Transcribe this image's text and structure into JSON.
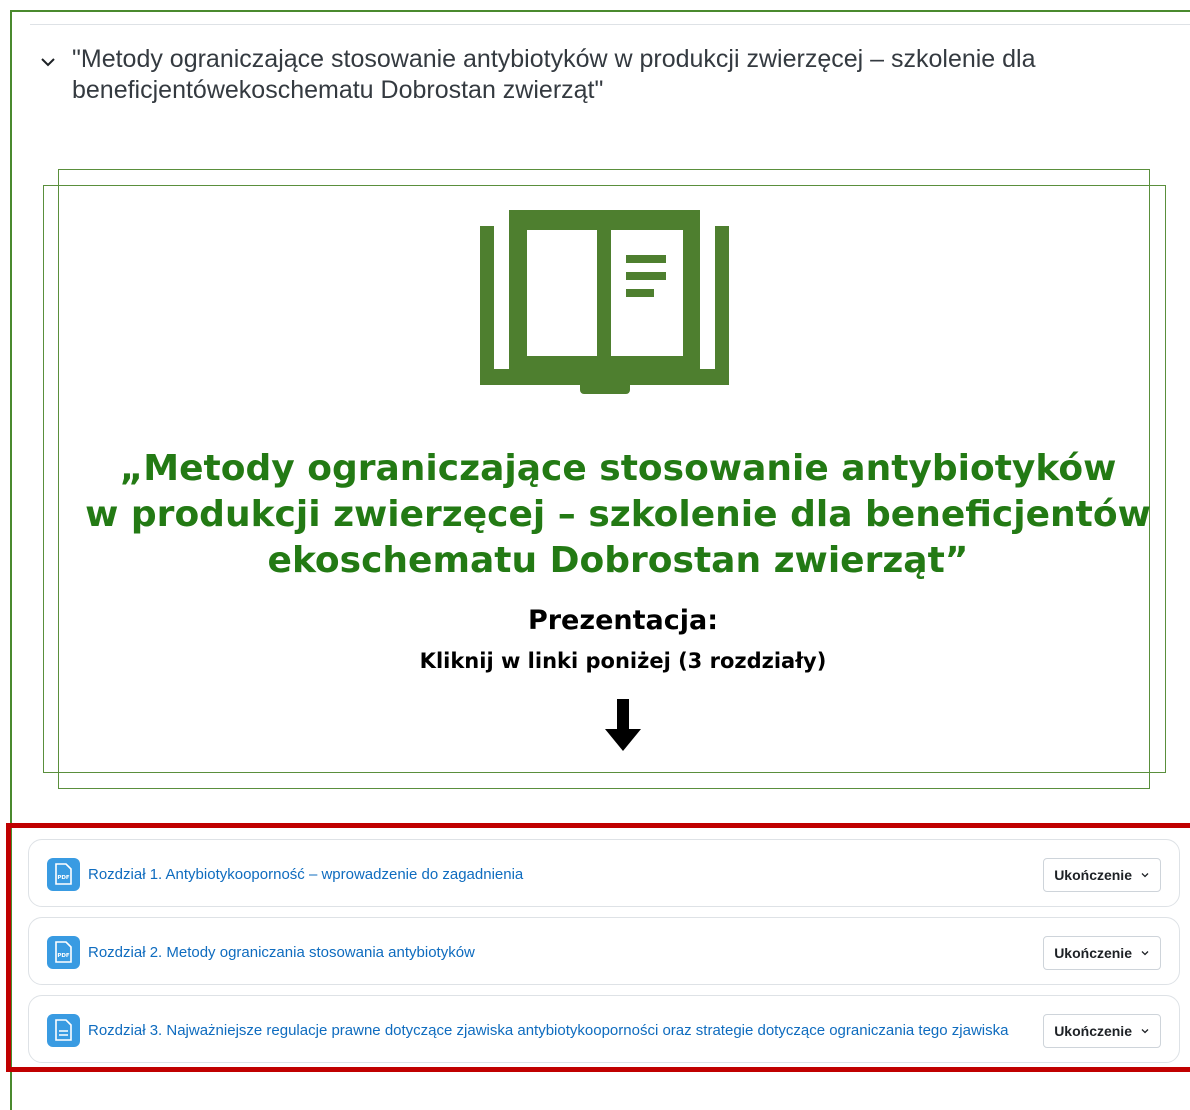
{
  "section": {
    "title": "\"Metody ograniczające stosowanie antybiotyków w produkcji zwierzęcej – szkolenie dla beneficjentówekoschematu Dobrostan zwierząt\""
  },
  "banner": {
    "title_line1": "„Metody ograniczające stosowanie antybiotyków",
    "title_line2": "w produkcji zwierzęcej – szkolenie dla beneficjentów",
    "title_line3": "ekoschematu Dobrostan zwierząt”",
    "subtitle": "Prezentacja:",
    "instruction": "Kliknij w linki poniżej (3 rozdziały)"
  },
  "activities": [
    {
      "label": "Rozdział 1. Antybiotykooporność – wprowadzenie do zagadnienia",
      "completion": "Ukończenie",
      "icon": "pdf-icon"
    },
    {
      "label": "Rozdział 2. Metody ograniczania stosowania antybiotyków",
      "completion": "Ukończenie",
      "icon": "pdf-icon"
    },
    {
      "label": "Rozdział 3. Najważniejsze regulacje prawne dotyczące zjawiska antybiotykooporności oraz strategie dotyczące ograniczania tego zjawiska",
      "completion": "Ukończenie",
      "icon": "file-icon"
    }
  ],
  "colors": {
    "brand_green": "#237a14",
    "frame_green": "#4a8a2e",
    "link_blue": "#0f6cbf",
    "icon_blue": "#399be2",
    "highlight_red": "#c00000"
  }
}
